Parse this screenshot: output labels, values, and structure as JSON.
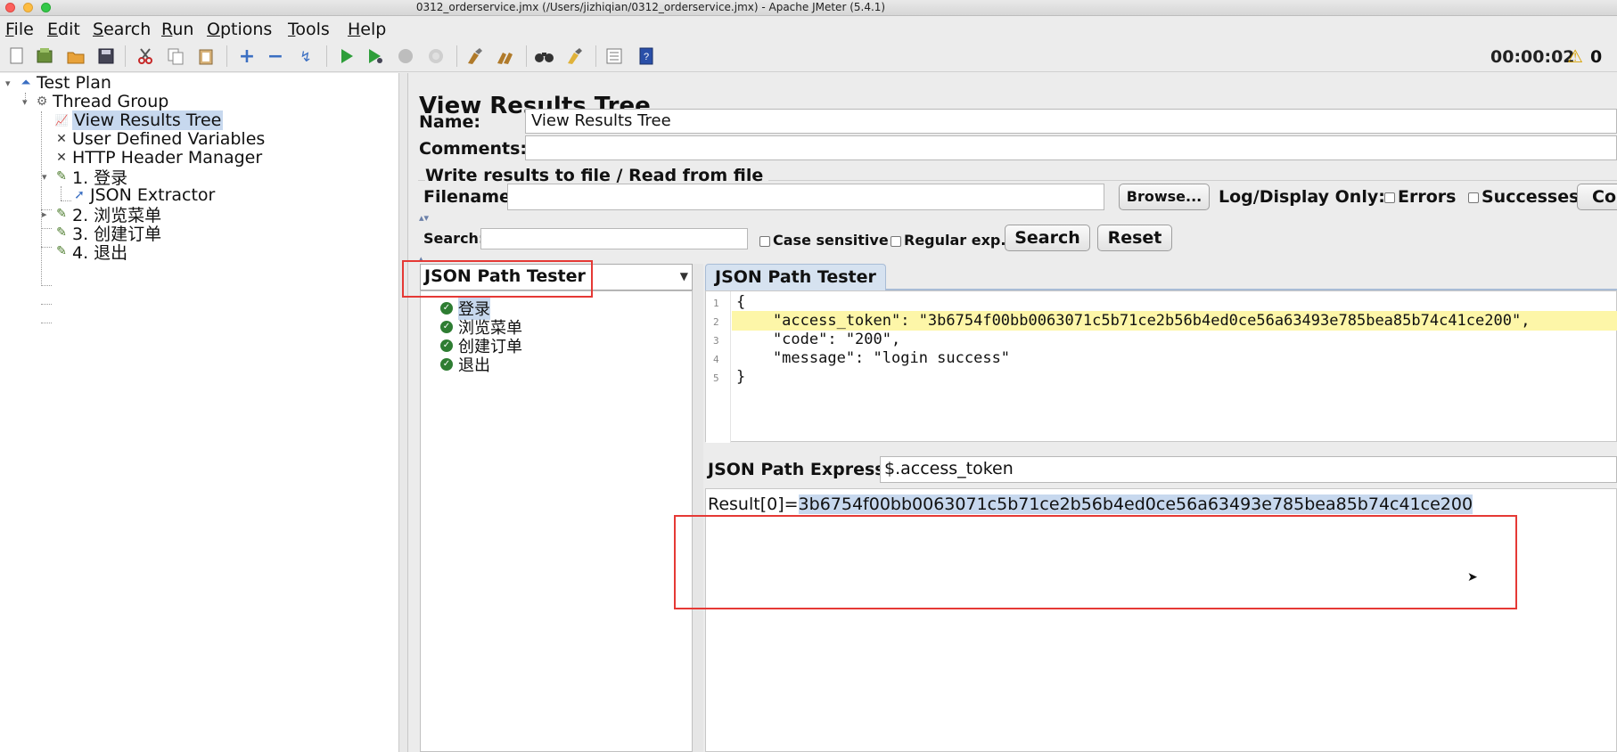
{
  "window": {
    "title": "0312_orderservice.jmx (/Users/jizhiqian/0312_orderservice.jmx) - Apache JMeter (5.4.1)"
  },
  "menu": {
    "items": [
      {
        "label": "File",
        "key": "F",
        "rest": "ile"
      },
      {
        "label": "Edit",
        "key": "E",
        "rest": "dit"
      },
      {
        "label": "Search",
        "key": "S",
        "rest": "earch"
      },
      {
        "label": "Run",
        "key": "R",
        "rest": "un"
      },
      {
        "label": "Options",
        "key": "O",
        "rest": "ptions"
      },
      {
        "label": "Tools",
        "key": "T",
        "rest": "ools"
      },
      {
        "label": "Help",
        "key": "H",
        "rest": "elp"
      }
    ]
  },
  "toolbar": {
    "timer": "00:00:02",
    "warning_icon": "⚠",
    "warning_count": "0"
  },
  "tree": {
    "nodes": [
      {
        "label": "Test Plan",
        "icon": "test-plan-icon"
      },
      {
        "label": "Thread Group",
        "icon": "gear-icon"
      },
      {
        "label": "View Results Tree",
        "icon": "chart-icon"
      },
      {
        "label": "User Defined Variables",
        "icon": "wrench-icon"
      },
      {
        "label": "HTTP Header Manager",
        "icon": "wrench-icon"
      },
      {
        "label": "1. 登录",
        "icon": "sampler-icon"
      },
      {
        "label": "JSON Extractor",
        "icon": "extractor-icon"
      },
      {
        "label": "2. 浏览菜单",
        "icon": "sampler-icon"
      },
      {
        "label": "3. 创建订单",
        "icon": "sampler-icon"
      },
      {
        "label": "4. 退出",
        "icon": "sampler-icon"
      }
    ]
  },
  "panel": {
    "title": "View Results Tree",
    "name_label": "Name:",
    "name_value": "View Results Tree",
    "comments_label": "Comments:",
    "comments_value": "",
    "write_results_label": "Write results to file / Read from file",
    "filename_label": "Filename",
    "filename_value": "",
    "browse_label": "Browse...",
    "log_display_label": "Log/Display Only:",
    "errors_label": "Errors",
    "successes_label": "Successes",
    "configure_label": "Co",
    "search_label": "Search:",
    "search_value": "",
    "case_sensitive_label": "Case sensitive",
    "regular_exp_label": "Regular exp.",
    "search_button": "Search",
    "reset_button": "Reset"
  },
  "results": {
    "renderer": "JSON Path Tester",
    "samples": [
      "登录",
      "浏览菜单",
      "创建订单",
      "退出"
    ],
    "selected_sample": "登录",
    "tab_label": "JSON Path Tester",
    "json_lines": [
      {
        "n": "1",
        "text": "{"
      },
      {
        "n": "2",
        "text": "    \"access_token\": \"3b6754f00bb0063071c5b71ce2b56b4ed0ce56a63493e785bea85b74c41ce200\","
      },
      {
        "n": "3",
        "text": "    \"code\": \"200\","
      },
      {
        "n": "4",
        "text": "    \"message\": \"login success\""
      },
      {
        "n": "5",
        "text": "}"
      }
    ],
    "expression_label": "JSON Path Expression",
    "expression_value": "$.access_token",
    "result_prefix": "Result[0]=",
    "result_value": "3b6754f00bb0063071c5b71ce2b56b4ed0ce56a63493e785bea85b74c41ce200"
  },
  "colors": {
    "highlight_box": "#e53935",
    "selection": "#c7d8ee",
    "line_highlight": "#fdf6a8"
  }
}
